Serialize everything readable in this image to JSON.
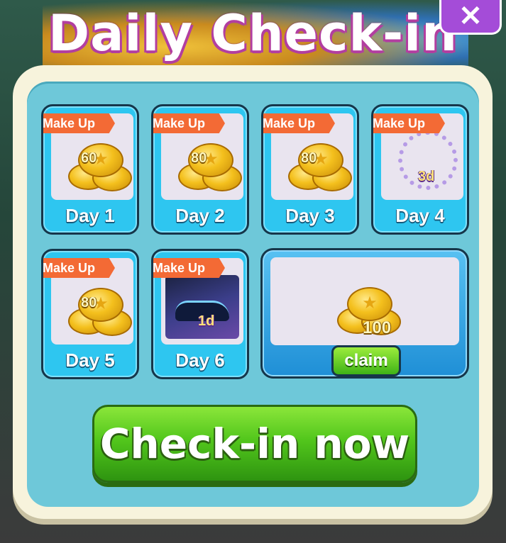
{
  "header": {
    "title": "Daily Check-in",
    "close_icon": "close-icon"
  },
  "makeup_label": "Make Up",
  "days": [
    {
      "label": "Day 1",
      "reward": "60",
      "reward_type": "coins"
    },
    {
      "label": "Day 2",
      "reward": "80",
      "reward_type": "coins"
    },
    {
      "label": "Day 3",
      "reward": "80",
      "reward_type": "coins"
    },
    {
      "label": "Day 4",
      "reward": "3d",
      "reward_type": "avatar-frame"
    },
    {
      "label": "Day 5",
      "reward": "80",
      "reward_type": "coins"
    },
    {
      "label": "Day 6",
      "reward": "1d",
      "reward_type": "car-skin"
    }
  ],
  "day7": {
    "reward": "100",
    "reward_type": "coins",
    "claim_label": "claim"
  },
  "checkin_button": "Check-in now",
  "colors": {
    "panel": "#6ec8d9",
    "card": "#2ec6f0",
    "tag": "#f36a35",
    "button": "#52c61c"
  }
}
